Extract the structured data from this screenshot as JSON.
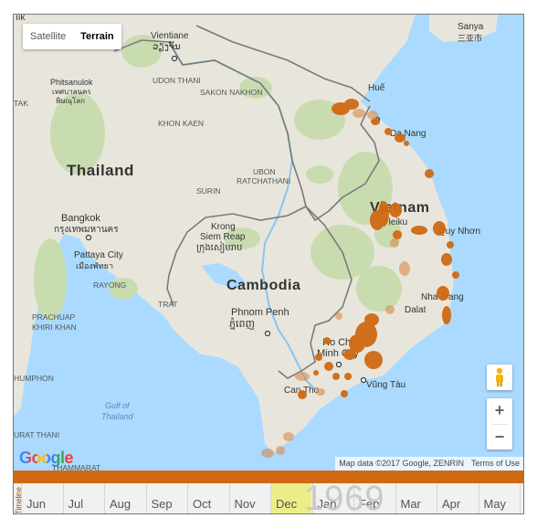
{
  "map": {
    "map_type_buttons": [
      {
        "label": "Satellite",
        "active": false
      },
      {
        "label": "Terrain",
        "active": true
      }
    ],
    "countries": [
      "Thailand",
      "Cambodia",
      "Vietnam"
    ],
    "cities": [
      {
        "name": "Vientiane",
        "alt": "ວຽງຈັນ"
      },
      {
        "name": "Bangkok",
        "alt": "กรุงเทพมหานคร"
      },
      {
        "name": "Pattaya City",
        "alt": "เมืองพัทยา"
      },
      {
        "name": "Phnom Penh",
        "alt": "ភ្នំពេញ"
      },
      {
        "name": "Siem Reap",
        "alt": "ក្រុងសៀមរាប"
      },
      {
        "name": "Ho Chi Minh City",
        "alt": ""
      },
      {
        "name": "Hue",
        "alt": ""
      },
      {
        "name": "Da Nang",
        "alt": ""
      },
      {
        "name": "Pleiku",
        "alt": ""
      },
      {
        "name": "Qui Nhon",
        "alt": ""
      },
      {
        "name": "Nha Trang",
        "alt": ""
      },
      {
        "name": "Dalat",
        "alt": ""
      },
      {
        "name": "Can Tho",
        "alt": ""
      },
      {
        "name": "Vung Tau",
        "alt": ""
      },
      {
        "name": "Sanya",
        "alt": "三亚市"
      },
      {
        "name": "Phitsanulok",
        "alt": "เทศบาลนคร พิษณุโลก"
      }
    ],
    "place_labels": {
      "vientiane": "Vientiane",
      "vientiane_alt": "ວຽງຈັນ",
      "udon": "UDON THANI",
      "sakon": "SAKON NAKHON",
      "khon": "KHON KAEN",
      "ubon_1": "UBON",
      "ubon_2": "RATCHATHANI",
      "surin": "SURIN",
      "phitsanulok": "Phitsanulok",
      "phitsanulok_alt_1": "เทศบาลนคร",
      "phitsanulok_alt_2": "พิษณุโลก",
      "thailand": "Thailand",
      "bangkok": "Bangkok",
      "bangkok_alt": "กรุงเทพมหานคร",
      "pattaya": "Pattaya City",
      "pattaya_alt": "เมืองพัทยา",
      "rayong": "RAYONG",
      "krong": "Krong",
      "siem": "Siem Reap",
      "siem_alt": "ក្រុងសៀមរាប",
      "cambodia": "Cambodia",
      "trat": "TRAT",
      "phnom": "Phnom Penh",
      "phnom_alt": "ភ្នំពេញ",
      "prachuap_1": "PRACHUAP",
      "prachuap_2": "KHIRI KHAN",
      "chumphon": "HUMPHON",
      "gulf_1": "Gulf of",
      "gulf_2": "Thailand",
      "surat": "URAT THANI",
      "thammarat": "THAMMARAT",
      "hue": "Huế",
      "danang": "Da Nang",
      "vietnam": "Vietnam",
      "pleiku": "Pleiku",
      "quinhon": "Quy Nhơn",
      "nhatrang": "Nha Trang",
      "dalat": "Dalat",
      "hcmc_1": "Ho Chi",
      "hcmc_2": "Minh City",
      "vungtau": "Vũng Tàu",
      "cantho": "Can Tho",
      "sanya": "Sanya",
      "sanya_alt": "三亚市",
      "tak": "TAK",
      "top_left": "ıık"
    },
    "attribution": {
      "map_data": "Map data ©2017 Google, ZENRIN",
      "terms": "Terms of Use"
    },
    "google_logo": "Google",
    "zoom_in": "+",
    "zoom_out": "−",
    "marker_color": "#cf6a13",
    "land_color": "#e8e6dc",
    "water_color": "#aadaff",
    "forest_color": "#c8dcb0"
  },
  "timeline": {
    "label": "Timeline",
    "year": "1969",
    "months": [
      "Jun",
      "Jul",
      "Aug",
      "Sep",
      "Oct",
      "Nov",
      "Dec",
      "Jan",
      "Feb",
      "Mar",
      "Apr",
      "May",
      "Jun"
    ],
    "highlighted_month": "Dec",
    "bar_color": "#cf6a13"
  }
}
